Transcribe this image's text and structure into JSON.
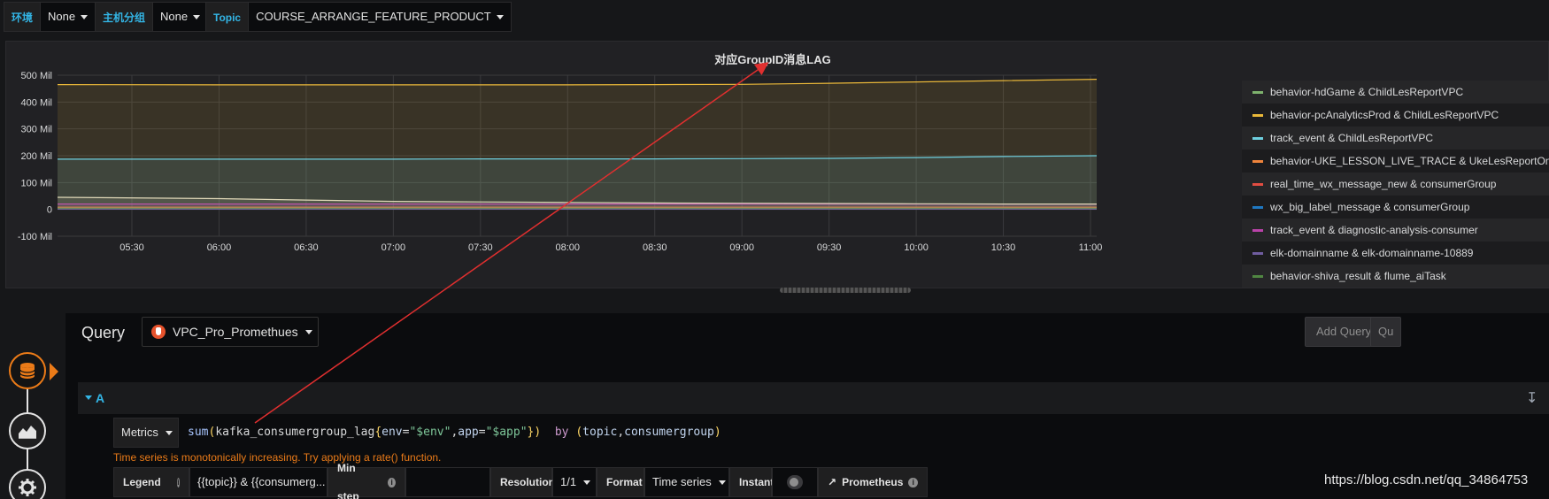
{
  "variables": [
    {
      "label": "环境",
      "value": "None"
    },
    {
      "label": "主机分组",
      "value": "None"
    },
    {
      "label": "Topic",
      "value": "COURSE_ARRANGE_FEATURE_PRODUCT"
    }
  ],
  "panel": {
    "title": "对应GroupID消息LAG"
  },
  "chart_data": {
    "type": "area",
    "title": "对应GroupID消息LAG",
    "xlabel": "",
    "ylabel": "",
    "x": [
      "05:30",
      "06:00",
      "06:30",
      "07:00",
      "07:30",
      "08:00",
      "08:30",
      "09:00",
      "09:30",
      "10:00",
      "10:30",
      "11:00"
    ],
    "y_ticks": [
      "500 Mil",
      "400 Mil",
      "300 Mil",
      "200 Mil",
      "100 Mil",
      "0",
      "-100 Mil"
    ],
    "ylim": [
      -100,
      500
    ],
    "y_unit": "Mil",
    "grid": true,
    "legend_position": "right",
    "series": [
      {
        "name": "behavior-hdGame & ChildLesReportVPC",
        "color": "#7eb26d",
        "values": [
          2,
          2,
          2,
          2,
          2,
          2,
          2,
          2,
          2,
          2,
          2,
          2
        ]
      },
      {
        "name": "behavior-pcAnalyticsProd & ChildLesReportVPC",
        "color": "#eab839",
        "values": [
          465,
          464,
          464,
          464,
          464,
          464,
          465,
          466,
          470,
          475,
          480,
          485
        ]
      },
      {
        "name": "track_event & ChildLesReportVPC",
        "color": "#6ed0e0",
        "values": [
          187,
          187,
          187,
          187,
          188,
          188,
          188,
          189,
          190,
          193,
          197,
          200
        ]
      },
      {
        "name": "behavior-UKE_LESSON_LIVE_TRACE & UkeLesReportOnline_",
        "color": "#ef843c",
        "values": [
          8,
          8,
          8,
          8,
          8,
          8,
          8,
          8,
          8,
          8,
          8,
          8
        ]
      },
      {
        "name": "real_time_wx_message_new & consumerGroup",
        "color": "#e24d42",
        "values": [
          3,
          3,
          3,
          3,
          3,
          3,
          3,
          3,
          3,
          3,
          3,
          3
        ]
      },
      {
        "name": "wx_big_label_message & consumerGroup",
        "color": "#1f78c1",
        "values": [
          1,
          1,
          1,
          1,
          1,
          1,
          1,
          1,
          1,
          1,
          1,
          1
        ]
      },
      {
        "name": "track_event & diagnostic-analysis-consumer",
        "color": "#ba43a9",
        "values": [
          20,
          20,
          20,
          20,
          20,
          20,
          20,
          20,
          20,
          20,
          20,
          20
        ]
      },
      {
        "name": "elk-domainname & elk-domainname-10889",
        "color": "#705da0",
        "values": [
          1,
          1,
          1,
          1,
          1,
          1,
          1,
          1,
          1,
          1,
          1,
          1
        ]
      },
      {
        "name": "behavior-shiva_result & flume_aiTask",
        "color": "#508642",
        "values": [
          5,
          5,
          5,
          5,
          5,
          5,
          5,
          5,
          5,
          5,
          5,
          5
        ]
      },
      {
        "name": "",
        "color": "#e0d8b8",
        "values": [
          45,
          40,
          35,
          30,
          28,
          26,
          24,
          23,
          22,
          21,
          20,
          20
        ]
      }
    ]
  },
  "query": {
    "title": "Query",
    "datasource": "VPC_Pro_Promethues",
    "add_query": "Add Query",
    "next_button": "Qu",
    "row_label": "A",
    "metrics_label": "Metrics",
    "expr": {
      "fn": "sum",
      "metric": "kafka_consumergroup_lag",
      "l1": "env",
      "v1": "\"$env\"",
      "l2": "app",
      "v2": "\"$app\"",
      "by": "by",
      "g1": "topic",
      "g2": "consumergroup"
    },
    "hint": "Time series is monotonically increasing. Try applying a rate() function.",
    "legend_label": "Legend",
    "legend_value": "{{topic}} & {{consumerg...",
    "min_step_label": "Min step",
    "min_step_value": "",
    "resolution_label": "Resolution",
    "resolution_value": "1/1",
    "format_label": "Format",
    "format_value": "Time series",
    "instant_label": "Instant",
    "prometheus_label": "Prometheus"
  },
  "watermark": "https://blog.csdn.net/qq_34864753",
  "colors": {
    "accent": "#33b5e5",
    "warning": "#eb7b18",
    "annotation_arrow": "#e02f2f"
  },
  "icons": [
    "database-icon",
    "chart-area-icon",
    "gear-icon",
    "prometheus-icon"
  ]
}
